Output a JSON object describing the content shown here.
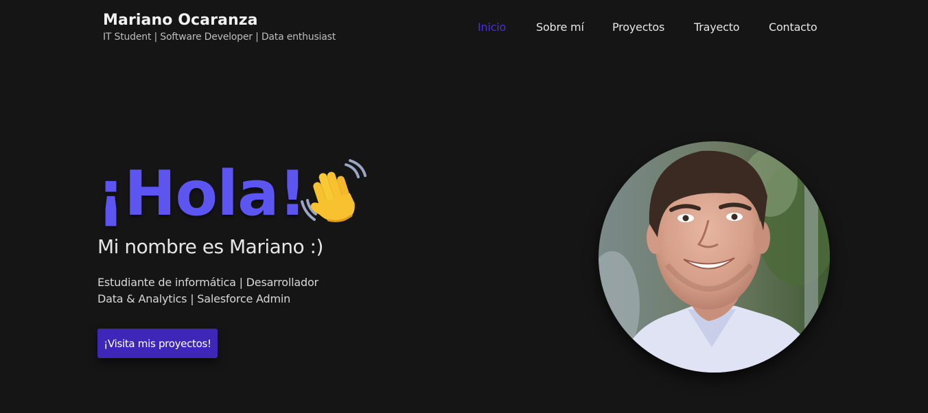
{
  "header": {
    "name": "Mariano Ocaranza",
    "tagline": "IT Student | Software Developer | Data enthusiast",
    "nav": [
      {
        "label": "Inicio",
        "active": true
      },
      {
        "label": "Sobre mí",
        "active": false
      },
      {
        "label": "Proyectos",
        "active": false
      },
      {
        "label": "Trayecto",
        "active": false
      },
      {
        "label": "Contacto",
        "active": false
      }
    ]
  },
  "hero": {
    "greeting": "¡Hola!",
    "greeting_icon": "waving-hand-icon",
    "subtitle": "Mi nombre es Mariano :)",
    "description": [
      "Estudiante de informática | Desarrollador",
      "Data & Analytics | Salesforce Admin"
    ],
    "cta_label": "¡Visita mis proyectos!",
    "photo": "profile-photo"
  },
  "colors": {
    "background": "#161516",
    "accent": "#5c55f2",
    "nav_active": "#4a32c9",
    "button": "#3e27b8"
  }
}
